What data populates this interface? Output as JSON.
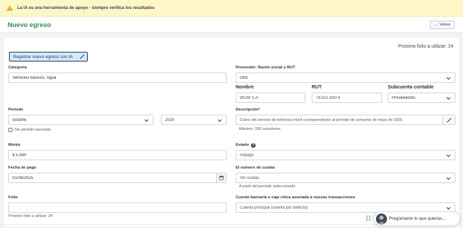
{
  "banner": {
    "text": "La IA es una herramienta de apoyo - siempre verifica los resultados",
    "icon": "warning-icon",
    "color": "#fdf6c9"
  },
  "header": {
    "title": "Nuevo egreso",
    "back_label": "Volver",
    "back_icon": "arrow-left-icon",
    "title_color": "#2e8a52"
  },
  "form": {
    "folio_top": "Próximo folio a utilizar: 24",
    "ia_button": "Registrar nuevo egreso con IA",
    "categoria": {
      "label": "Categoría",
      "value": "Servicios básicos, Agua"
    },
    "proveedor": {
      "label": "Proveedor: Razón social y RUT",
      "value": "Otro"
    },
    "nombre": {
      "label": "Nombre",
      "value": "WOM S.A."
    },
    "rut": {
      "label": "RUT",
      "value": "78.921.690-8"
    },
    "subcuenta": {
      "label": "Subcuenta contable",
      "value": "Proveedores"
    },
    "periodo": {
      "label": "Periodo",
      "month": "octubre",
      "year": "2025",
      "checkbox_label": "Sin periodo asociado."
    },
    "descripcion": {
      "label": "Descripción*",
      "value": "Cobro del servicio de telefonía móvil correspondiente al período de consumo de mayo de 2025.",
      "hint": "Máximo: 150 caracteres."
    },
    "monto": {
      "label": "Monto",
      "value": "$ 5.990"
    },
    "estado": {
      "label": "Estado",
      "value": "Impago"
    },
    "fecha": {
      "label": "Fecha de pago",
      "value": "01/06/2025"
    },
    "cuotas": {
      "label": "El número de cuotas",
      "value": "Sin cuotas",
      "hint": "A partir del período seleccionado"
    },
    "folio": {
      "label": "Folio",
      "value": "",
      "hint": "Próximo folio a utilizar: 24"
    },
    "cuenta": {
      "label": "Cuenta bancaria o caja chica asociada a nuevas transacciones",
      "value": "Cuenta principal (cuenta por defecto)"
    }
  },
  "chat": {
    "placeholder": "Pregúntame lo que quieras..."
  }
}
